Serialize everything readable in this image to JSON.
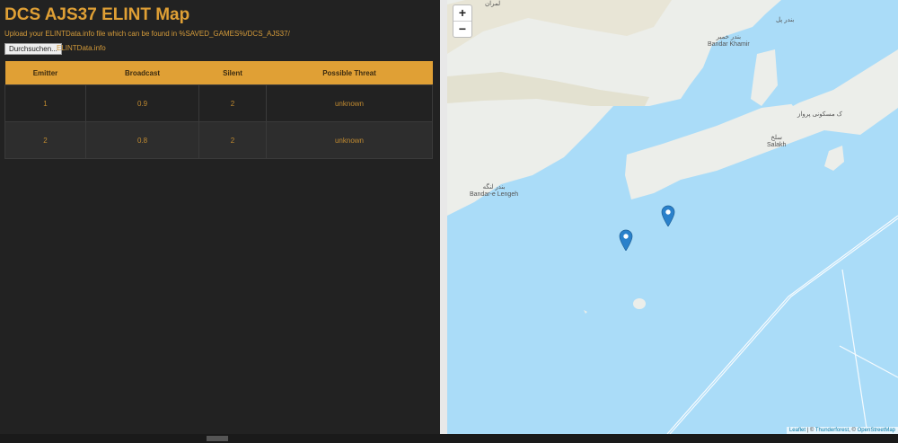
{
  "title": "DCS AJS37 ELINT Map",
  "upload_hint": "Upload your ELINTData.info file which can be found in %SAVED_GAMES%/DCS_AJS37/",
  "file_button": "Durchsuchen...",
  "file_name": "ELINTData.info",
  "table": {
    "headers": [
      "Emitter",
      "Broadcast",
      "Silent",
      "Possible Threat"
    ],
    "rows": [
      [
        "1",
        "0.9",
        "2",
        "unknown"
      ],
      [
        "2",
        "0.8",
        "2",
        "unknown"
      ]
    ]
  },
  "map": {
    "zoom_in": "+",
    "zoom_out": "−",
    "labels": {
      "lamran": "لمران",
      "bandar_pol": "بندر پل",
      "bandar_khamir_fa": "بندر خمیر",
      "bandar_khamir": "Bandar Khamir",
      "salakh_fa": "سلخ",
      "salakh": "Salakh",
      "parvar_fa": "ک مسکونی پرواز",
      "lengeh_fa": "بندر لنگه",
      "lengeh": "Bandar-e Lengeh"
    },
    "attribution": {
      "leaflet": "Leaflet",
      "sep": " | © ",
      "thunderforest": "Thunderforest",
      "sep2": ", © ",
      "osm": "OpenStreetMap"
    }
  },
  "colors": {
    "accent": "#e0a035",
    "water": "#aadcf8",
    "marker": "#2a81cb"
  }
}
